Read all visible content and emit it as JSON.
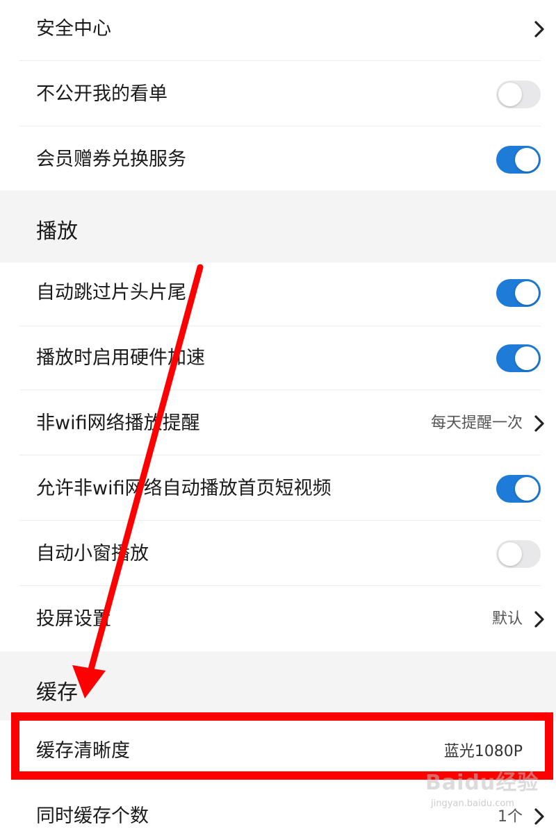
{
  "settings": {
    "security_center": "安全中心",
    "hide_watchlist": "不公开我的看单",
    "member_coupon": "会员赠券兑换服务",
    "playback_section": "播放",
    "auto_skip": "自动跳过片头片尾",
    "hw_accel": "播放时启用硬件加速",
    "non_wifi_reminder": "非wifi网络播放提醒",
    "non_wifi_reminder_value": "每天提醒一次",
    "allow_autoplay": "允许非wifi网络自动播放首页短视频",
    "mini_window": "自动小窗播放",
    "cast_settings": "投屏设置",
    "cast_settings_value": "默认",
    "cache_section": "缓存",
    "cache_quality": "缓存清晰度",
    "cache_quality_value": "蓝光1080P",
    "concurrent_cache": "同时缓存个数",
    "concurrent_cache_value": "1个"
  },
  "toggles": {
    "hide_watchlist": false,
    "member_coupon": true,
    "auto_skip": true,
    "hw_accel": true,
    "allow_autoplay": true,
    "mini_window": false
  },
  "watermark": {
    "brand": "Baidu经验",
    "url": "jingyan.baidu.com"
  },
  "colors": {
    "toggle_on": "#1e7bd8",
    "toggle_off": "#e8e8ea",
    "annotation": "#ff0000",
    "section_bg": "#f4f4f5"
  }
}
